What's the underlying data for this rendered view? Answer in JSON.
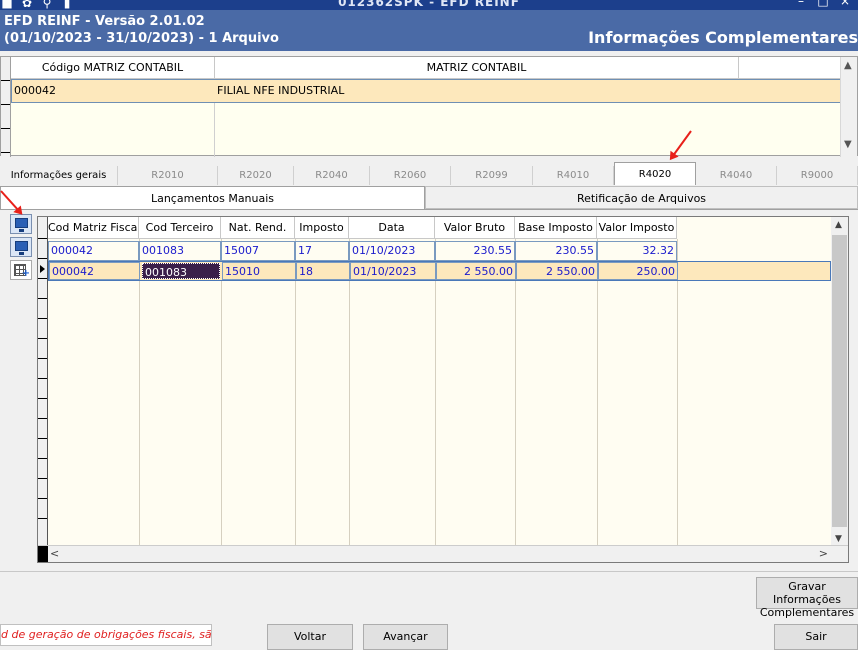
{
  "window": {
    "title": "012362SPK - EFD REINF",
    "icons": [
      "app-icon",
      "gear-icon",
      "search-icon",
      "book-icon"
    ],
    "controls": [
      "minimize-icon",
      "maximize-icon",
      "close-icon"
    ]
  },
  "header": {
    "line1": "EFD REINF - Versão 2.01.02",
    "line2": "(01/10/2023 - 31/10/2023) - 1 Arquivo",
    "section": "Informações Complementares"
  },
  "upper_grid": {
    "columns": [
      "Código MATRIZ CONTABIL",
      "MATRIZ CONTABIL"
    ],
    "rows": [
      [
        "000042",
        "FILIAL NFE INDUSTRIAL"
      ]
    ]
  },
  "tabs": [
    "Informações gerais",
    "R2010",
    "R2020",
    "R2040",
    "R2060",
    "R2099",
    "R4010",
    "R4020",
    "R4040",
    "R9000"
  ],
  "active_tab": "R4020",
  "subtabs": {
    "active": "Lançamentos Manuais",
    "other": "Retificação de Arquivos"
  },
  "toolbar": {
    "buttons": [
      "monitor-icon",
      "monitor-icon",
      "add-table-icon"
    ]
  },
  "main_grid": {
    "columns": [
      "Cod Matriz Fiscal",
      "Cod Terceiro",
      "Nat. Rend.",
      "Imposto",
      "Data",
      "Valor Bruto",
      "Base Imposto",
      "Valor Imposto"
    ],
    "rows": [
      [
        "000042",
        "001083",
        "15007",
        "17",
        "01/10/2023",
        "230.55",
        "230.55",
        "32.32"
      ],
      [
        "000042",
        "001083",
        "15010",
        "18",
        "01/10/2023",
        "2 550.00",
        "2 550.00",
        "250.00"
      ]
    ],
    "selected_row": 1
  },
  "buttons": {
    "gravar_line1": "Gravar Informações",
    "gravar_line2": "Complementares",
    "voltar": "Voltar",
    "avancar": "Avançar",
    "sair": "Sair"
  },
  "status_text": "d de geração de obrigações fiscais, são de ;",
  "colors": {
    "title_bar": "#1c3f8c",
    "header_band": "#4a6aa6",
    "selected_row": "#fde8bc",
    "grid_text": "#1a1acc",
    "status_text": "#e02020",
    "annotation_arrow": "#e8201a"
  }
}
